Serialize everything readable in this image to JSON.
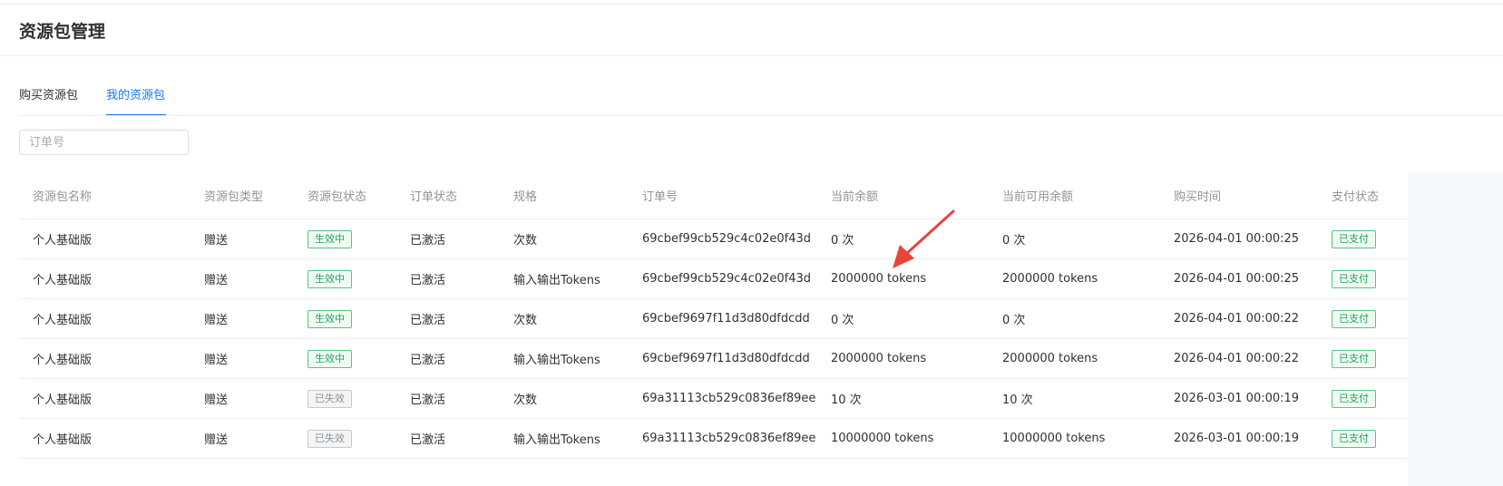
{
  "page": {
    "title": "资源包管理"
  },
  "tabs": [
    {
      "label": "购买资源包",
      "active": false
    },
    {
      "label": "我的资源包",
      "active": true
    }
  ],
  "search": {
    "placeholder": "订单号",
    "value": ""
  },
  "table": {
    "columns": [
      "资源包名称",
      "资源包类型",
      "资源包状态",
      "订单状态",
      "规格",
      "订单号",
      "当前余额",
      "当前可用余额",
      "购买时间",
      "支付状态"
    ],
    "rows": [
      {
        "name": "个人基础版",
        "type": "赠送",
        "status": "生效中",
        "status_kind": "active",
        "order_status": "已激活",
        "spec": "次数",
        "order_no": "69cbef99cb529c4c02e0f43d",
        "balance": "0 次",
        "available": "0 次",
        "purchased_at": "2026-04-01 00:00:25",
        "payment": "已支付"
      },
      {
        "name": "个人基础版",
        "type": "赠送",
        "status": "生效中",
        "status_kind": "active",
        "order_status": "已激活",
        "spec": "输入输出Tokens",
        "order_no": "69cbef99cb529c4c02e0f43d",
        "balance": "2000000 tokens",
        "available": "2000000 tokens",
        "purchased_at": "2026-04-01 00:00:25",
        "payment": "已支付"
      },
      {
        "name": "个人基础版",
        "type": "赠送",
        "status": "生效中",
        "status_kind": "active",
        "order_status": "已激活",
        "spec": "次数",
        "order_no": "69cbef9697f11d3d80dfdcdd",
        "balance": "0 次",
        "available": "0 次",
        "purchased_at": "2026-04-01 00:00:22",
        "payment": "已支付"
      },
      {
        "name": "个人基础版",
        "type": "赠送",
        "status": "生效中",
        "status_kind": "active",
        "order_status": "已激活",
        "spec": "输入输出Tokens",
        "order_no": "69cbef9697f11d3d80dfdcdd",
        "balance": "2000000 tokens",
        "available": "2000000 tokens",
        "purchased_at": "2026-04-01 00:00:22",
        "payment": "已支付"
      },
      {
        "name": "个人基础版",
        "type": "赠送",
        "status": "已失效",
        "status_kind": "expired",
        "order_status": "已激活",
        "spec": "次数",
        "order_no": "69a31113cb529c0836ef89ee",
        "balance": "10 次",
        "available": "10 次",
        "purchased_at": "2026-03-01 00:00:19",
        "payment": "已支付"
      },
      {
        "name": "个人基础版",
        "type": "赠送",
        "status": "已失效",
        "status_kind": "expired",
        "order_status": "已激活",
        "spec": "输入输出Tokens",
        "order_no": "69a31113cb529c0836ef89ee",
        "balance": "10000000 tokens",
        "available": "10000000 tokens",
        "purchased_at": "2026-03-01 00:00:19",
        "payment": "已支付"
      }
    ]
  },
  "colors": {
    "accent": "#1677ff",
    "tag_active": "#22a55a",
    "tag_expired": "#909399",
    "annotation_arrow": "#e8453c"
  }
}
